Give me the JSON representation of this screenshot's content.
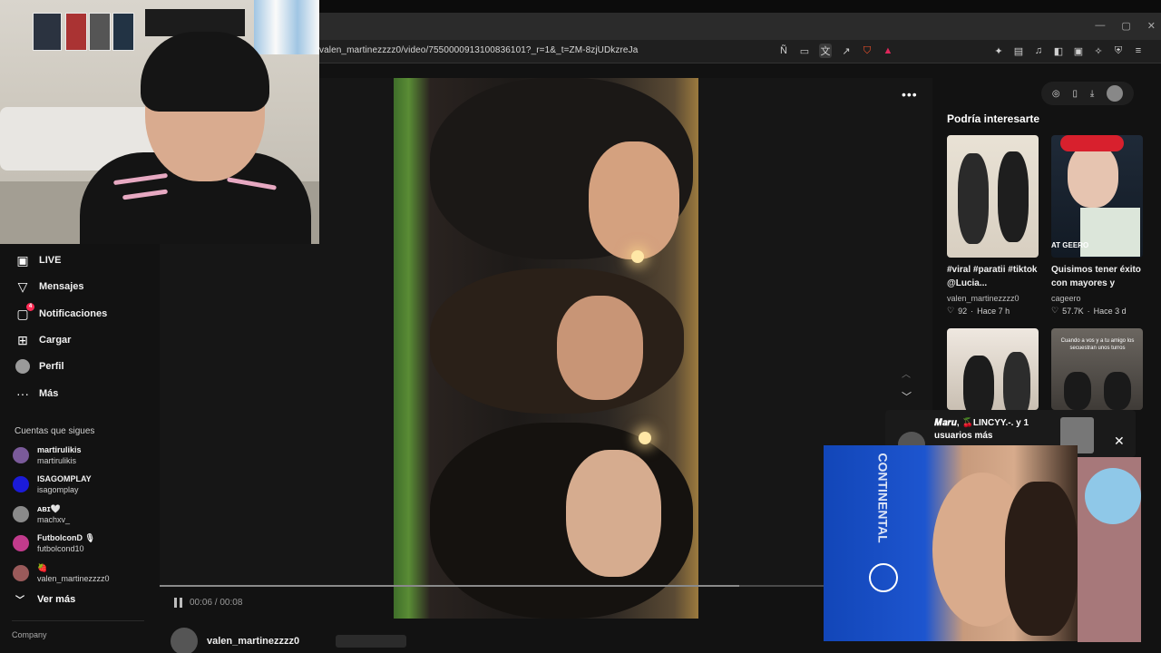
{
  "browser": {
    "url": "valen_martinezzzz0/video/7550000913100836101?_r=1&_t=ZM-8zjUDkzreJa",
    "window_controls": [
      "—",
      "▢",
      "✕"
    ]
  },
  "sidebar": {
    "nav": [
      {
        "label": "LIVE",
        "icon": "live-icon"
      },
      {
        "label": "Mensajes",
        "icon": "send-icon"
      },
      {
        "label": "Notificaciones",
        "icon": "inbox-icon",
        "badge": "4"
      },
      {
        "label": "Cargar",
        "icon": "upload-icon"
      },
      {
        "label": "Perfil",
        "icon": "profile-icon"
      },
      {
        "label": "Más",
        "icon": "more-icon"
      }
    ],
    "following_title": "Cuentas que sigues",
    "following": [
      {
        "name": "martirulikis",
        "user": "martirulikis",
        "color": "#7a5a9a"
      },
      {
        "name": "ISAGOMPLAY",
        "user": "isagomplay",
        "color": "#1b1bd8"
      },
      {
        "name": "ᴀʙɪ🤍",
        "user": "machxv_",
        "color": "#8a8a8a"
      },
      {
        "name": "FutbolconD 🎙",
        "user": "futbolcond10",
        "color": "#c23b8c"
      },
      {
        "name": "🍓",
        "user": "valen_martinezzzz0",
        "color": "#9a5a5a"
      }
    ],
    "see_more": "Ver más",
    "company": "Company"
  },
  "player": {
    "more": "•••",
    "time": "00:06 / 00:08",
    "progress": 0.75,
    "author": "valen_martinezzzz0"
  },
  "recommendations": {
    "title": "Podría interesarte",
    "items": [
      {
        "caption": "#viral #paratii #tiktok @Lucia...",
        "user": "valen_martinezzzz0",
        "likes": "92",
        "age": "Hace 7 h"
      },
      {
        "caption": "Quisimos tener éxito con mayores y esto...",
        "user": "cageero",
        "likes": "57.7K",
        "age": "Hace 3 d"
      },
      {
        "caption": "",
        "user": "",
        "likes": "",
        "age": ""
      },
      {
        "caption": "",
        "user": "",
        "likes": "",
        "age": ""
      }
    ],
    "thumb2_overlay_text": "AT GEERO",
    "thumb4_overlay_text": "Cuando a vos y a tu amigo los secuestran unos turros"
  },
  "popup": {
    "text": "𝑴𝒂𝒓𝒖, 🍒LINCYY.-. y 1 usuarios más",
    "close": "✕"
  },
  "overlay": {
    "jersey_text": "CONTINENTAL"
  },
  "colors": {
    "accent": "#fe2c55",
    "background": "#121212"
  }
}
